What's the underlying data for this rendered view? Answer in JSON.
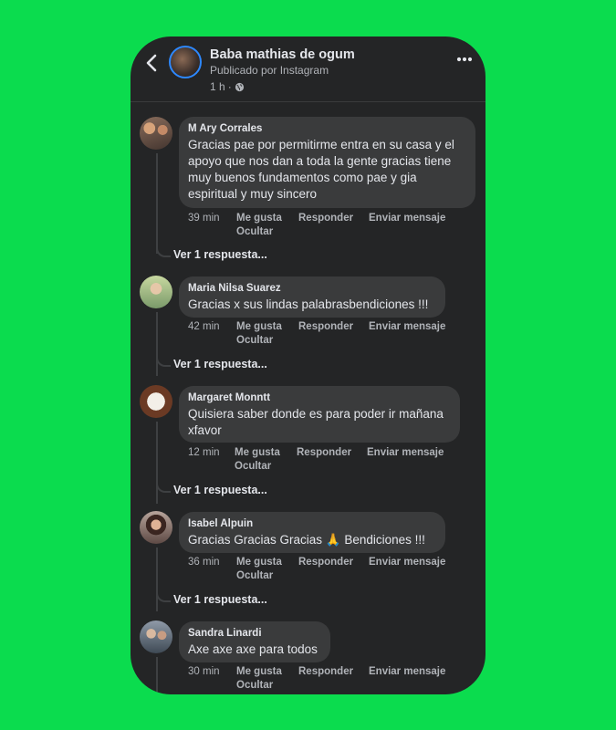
{
  "post": {
    "page_name": "Baba mathias de ogum",
    "subtitle": "Publicado por Instagram",
    "time": "1 h",
    "separator": "·"
  },
  "comments": [
    {
      "author": "M Ary Corrales",
      "text": "Gracias pae por  permitirme entra en su casa y el apoyo que nos dan a toda la gente gracias  tiene muy buenos fundamentos  como pae  y gia espiritual  y muy sincero",
      "time": "39 min",
      "like": "Me gusta",
      "reply": "Responder",
      "message": "Enviar mensaje",
      "hide": "Ocultar",
      "replies_link": "Ver 1 respuesta..."
    },
    {
      "author": "Maria Nilsa Suarez",
      "text": "Gracias x sus lindas palabrasbendiciones !!!",
      "time": "42 min",
      "like": "Me gusta",
      "reply": "Responder",
      "message": "Enviar mensaje",
      "hide": "Ocultar",
      "replies_link": "Ver 1 respuesta..."
    },
    {
      "author": "Margaret Monntt",
      "text": "Quisiera saber donde es para poder ir mañana xfavor",
      "time": "12 min",
      "like": "Me gusta",
      "reply": "Responder",
      "message": "Enviar mensaje",
      "hide": "Ocultar",
      "replies_link": "Ver 1 respuesta..."
    },
    {
      "author": "Isabel Alpuin",
      "text": "Gracias Gracias Gracias 🙏 Bendiciones  !!!",
      "time": "36 min",
      "like": "Me gusta",
      "reply": "Responder",
      "message": "Enviar mensaje",
      "hide": "Ocultar",
      "replies_link": "Ver 1 respuesta..."
    },
    {
      "author": "Sandra Linardi",
      "text": "Axe axe axe para todos",
      "time": "30 min",
      "like": "Me gusta",
      "reply": "Responder",
      "message": "Enviar mensaje",
      "hide": "Ocultar"
    }
  ],
  "colors": {
    "background": "#0bdc4e",
    "panel": "#242526",
    "bubble": "#3a3b3c",
    "primary_text": "#e4e6eb",
    "secondary_text": "#b0b3b8",
    "story_ring": "#2d88ff"
  },
  "icons": {
    "back": "chevron-left-icon",
    "globe": "globe-icon",
    "more": "more-horizontal-icon"
  }
}
